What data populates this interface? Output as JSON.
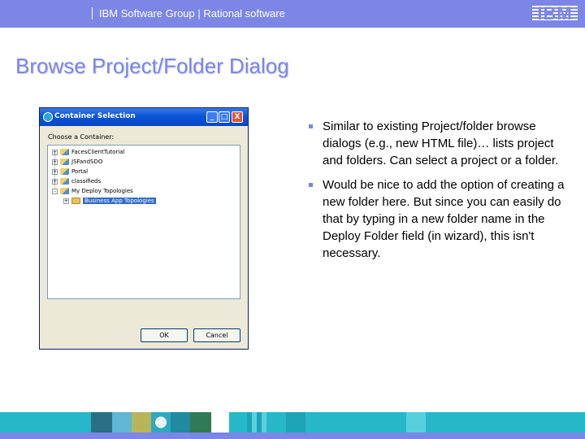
{
  "header": {
    "group_text": "IBM Software Group | Rational software",
    "logo_text": "IBM"
  },
  "slide": {
    "title": "Browse Project/Folder Dialog"
  },
  "dialog": {
    "title": "Container Selection",
    "buttons": {
      "minimize": "_",
      "maximize": "□",
      "close": "X"
    },
    "label": "Choose a Container:",
    "tree": [
      {
        "label": "FacesClientTutorial",
        "toggle": "+",
        "icon": "project"
      },
      {
        "label": "JSFandSDO",
        "toggle": "+",
        "icon": "project"
      },
      {
        "label": "Portal",
        "toggle": "+",
        "icon": "project"
      },
      {
        "label": "classifieds",
        "toggle": "+",
        "icon": "project"
      },
      {
        "label": "My Deploy Topologies",
        "toggle": "-",
        "icon": "project"
      },
      {
        "label": "Business App Topologies",
        "toggle": "+",
        "icon": "folder",
        "selected": true
      }
    ],
    "ok_label": "OK",
    "cancel_label": "Cancel"
  },
  "bullets": [
    "Similar to existing Project/folder browse dialogs (e.g., new HTML file)… lists project and folders. Can select a project or a folder.",
    "Would be nice to add the option of creating a new folder here.  But since you can easily do that by typing in a new folder name in the Deploy Folder field (in wizard), this isn't necessary."
  ],
  "colors": {
    "accent": "#7b86e6",
    "footer": "#26b8c8"
  }
}
